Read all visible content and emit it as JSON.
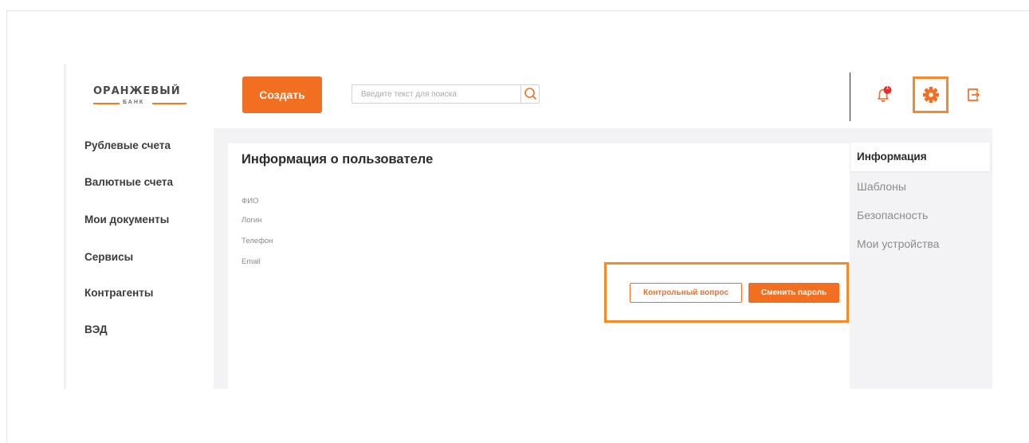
{
  "brand": {
    "name": "ОРАНЖЕВЫЙ",
    "sub": "БАНК",
    "accent": "#f26f21",
    "highlight": "#f7892b"
  },
  "header": {
    "create_label": "Создать",
    "search_placeholder": "Введите текст для поиска",
    "search_value": "",
    "notification_count": "1",
    "icons": [
      "search-icon",
      "bell-icon",
      "gear-icon",
      "logout-icon"
    ]
  },
  "sidebar": {
    "items": [
      {
        "label": "Рублевые счета"
      },
      {
        "label": "Валютные счета"
      },
      {
        "label": "Мои документы"
      },
      {
        "label": "Сервисы"
      },
      {
        "label": "Контрагенты"
      },
      {
        "label": "ВЭД"
      }
    ]
  },
  "main": {
    "title": "Информация о пользователе",
    "fields": [
      {
        "label": "ФИО"
      },
      {
        "label": "Логин"
      },
      {
        "label": "Телефон"
      },
      {
        "label": "Email"
      }
    ],
    "security_question_label": "Контрольный вопрос",
    "change_password_label": "Сменить пароль"
  },
  "tabs": {
    "items": [
      {
        "label": "Информация",
        "active": true
      },
      {
        "label": "Шаблоны",
        "active": false
      },
      {
        "label": "Безопасность",
        "active": false
      },
      {
        "label": "Мои устройства",
        "active": false
      }
    ]
  }
}
